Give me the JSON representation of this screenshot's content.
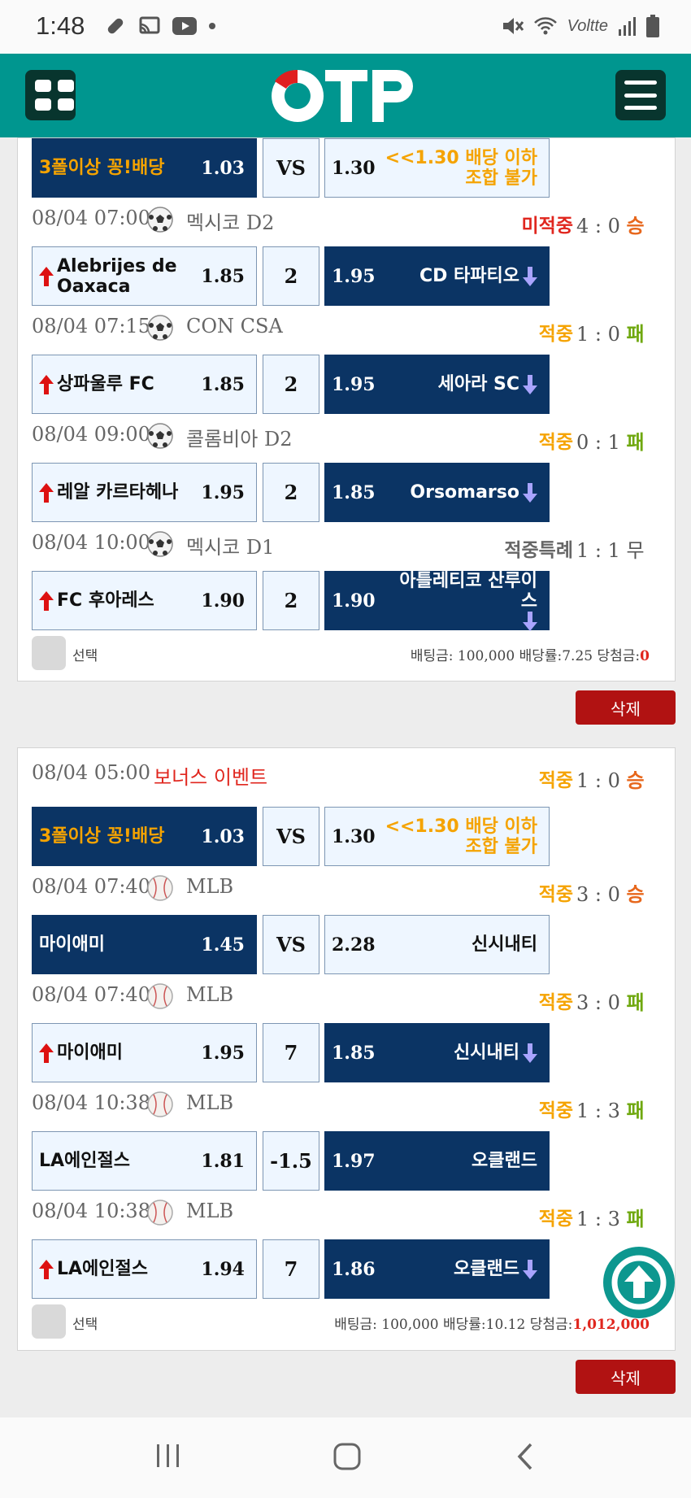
{
  "status_bar": {
    "time": "1:48",
    "network": "Voltte"
  },
  "header": {
    "logo_text": "OTP",
    "menu_icon": "hamburger-icon",
    "grid_icon": "grid-icon"
  },
  "colors": {
    "teal": "#00968f",
    "navy": "#0b3464",
    "win_gold": "#f5a300",
    "lose_red": "#e0261e",
    "delete_red": "#b11212",
    "result_win": "#e7671c",
    "result_loss": "#6fa80f"
  },
  "card1": {
    "partial_match": {
      "home": "3폴이상 꽁!배당",
      "home_odd": "1.03",
      "mid": "VS",
      "away_odd": "1.30",
      "away": "<<1.30 배당 이하 조합 불가"
    },
    "games": [
      {
        "datetime": "08/04 07:00",
        "sport": "soccer-ball-icon",
        "league": "멕시코 D2",
        "status": "미적중",
        "score": "4 : 0",
        "result": "승",
        "home": "Alebrijes de Oaxaca",
        "home_odd": "1.85",
        "mid": "2",
        "away_odd": "1.95",
        "away": "CD 타파티오",
        "selected": "away"
      },
      {
        "datetime": "08/04 07:15",
        "sport": "soccer-ball-icon",
        "league": "CON CSA",
        "status": "적중",
        "score": "1 : 0",
        "result": "패",
        "home": "상파울루 FC",
        "home_odd": "1.85",
        "mid": "2",
        "away_odd": "1.95",
        "away": "세아라 SC",
        "selected": "away"
      },
      {
        "datetime": "08/04 09:00",
        "sport": "soccer-ball-icon",
        "league": "콜롬비아 D2",
        "status": "적중",
        "score": "0 : 1",
        "result": "패",
        "home": "레알 카르타헤나",
        "home_odd": "1.95",
        "mid": "2",
        "away_odd": "1.85",
        "away": "Orsomarso",
        "selected": "away"
      },
      {
        "datetime": "08/04 10:00",
        "sport": "soccer-ball-icon",
        "league": "멕시코 D1",
        "status": "적중특례",
        "score": "1 : 1",
        "result": "무",
        "home": "FC 후아레스",
        "home_odd": "1.90",
        "mid": "2",
        "away_odd": "1.90",
        "away": "아틀레티코 산루이스",
        "selected": "away"
      }
    ],
    "checkbox_label": "선택",
    "summary_prefix": "배팅금: 100,000 배당률:7.25 당첨금:",
    "summary_win": "0",
    "delete_label": "삭제"
  },
  "card2": {
    "games": [
      {
        "datetime": "08/04 05:00",
        "league": "보너스 이벤트",
        "status": "적중",
        "score": "1 : 0",
        "result": "승",
        "home": "3폴이상 꽁!배당",
        "home_odd": "1.03",
        "mid": "VS",
        "away_odd": "1.30",
        "away": "<<1.30 배당 이하 조합 불가",
        "selected": "home"
      },
      {
        "datetime": "08/04 07:40",
        "sport": "baseball-icon",
        "league": "MLB",
        "status": "적중",
        "score": "3 : 0",
        "result": "승",
        "home": "마이애미",
        "home_odd": "1.45",
        "mid": "VS",
        "away_odd": "2.28",
        "away": "신시내티",
        "selected": "home"
      },
      {
        "datetime": "08/04 07:40",
        "sport": "baseball-icon",
        "league": "MLB",
        "status": "적중",
        "score": "3 : 0",
        "result": "패",
        "home": "마이애미",
        "home_odd": "1.95",
        "mid": "7",
        "away_odd": "1.85",
        "away": "신시내티",
        "selected": "away"
      },
      {
        "datetime": "08/04 10:38",
        "sport": "baseball-icon",
        "league": "MLB",
        "status": "적중",
        "score": "1 : 3",
        "result": "패",
        "home": "LA에인절스",
        "home_odd": "1.81",
        "mid": "-1.5",
        "away_odd": "1.97",
        "away": "오클랜드",
        "selected": "away"
      },
      {
        "datetime": "08/04 10:38",
        "sport": "baseball-icon",
        "league": "MLB",
        "status": "적중",
        "score": "1 : 3",
        "result": "패",
        "home": "LA에인절스",
        "home_odd": "1.94",
        "mid": "7",
        "away_odd": "1.86",
        "away": "오클랜드",
        "selected": "away"
      }
    ],
    "checkbox_label": "선택",
    "summary_prefix": "배팅금: 100,000 배당률:10.12 당첨금:",
    "summary_win": "1,012,000",
    "delete_label": "삭제"
  }
}
